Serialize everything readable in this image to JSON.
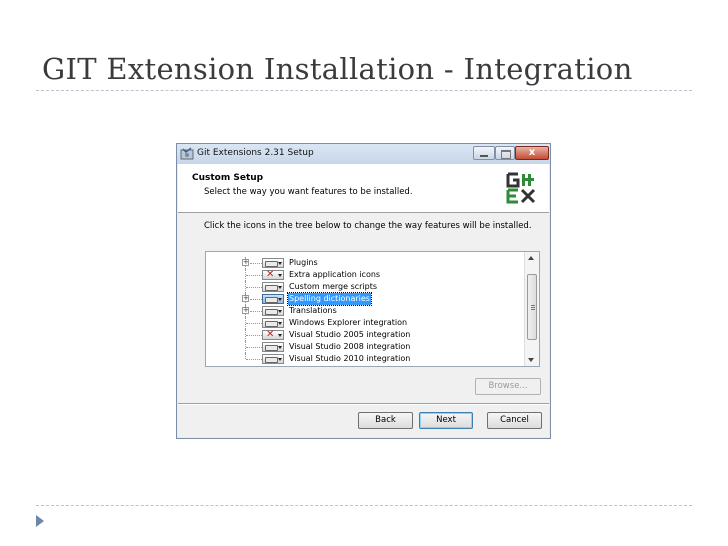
{
  "slide": {
    "title": "GIT Extension Installation - Integration"
  },
  "window": {
    "title": "Git Extensions 2.31 Setup",
    "close_symbol": "x",
    "header": {
      "title": "Custom Setup",
      "subtitle": "Select the way you want features to be installed."
    },
    "instructions": "Click the icons in the tree below to change the way features will be installed.",
    "features": [
      {
        "label": "Plugins",
        "state": "installed",
        "expandable": true
      },
      {
        "label": "Extra application icons",
        "state": "not-installed",
        "expandable": false
      },
      {
        "label": "Custom merge scripts",
        "state": "installed",
        "expandable": false
      },
      {
        "label": "Spelling dictionaries",
        "state": "installed",
        "expandable": true,
        "selected": true
      },
      {
        "label": "Translations",
        "state": "installed",
        "expandable": true
      },
      {
        "label": "Windows Explorer integration",
        "state": "installed",
        "expandable": false
      },
      {
        "label": "Visual Studio 2005 integration",
        "state": "not-installed",
        "expandable": false
      },
      {
        "label": "Visual Studio 2008 integration",
        "state": "installed",
        "expandable": false
      },
      {
        "label": "Visual Studio 2010 integration",
        "state": "installed",
        "expandable": false
      }
    ],
    "buttons": {
      "browse": "Browse...",
      "back": "Back",
      "next": "Next",
      "cancel": "Cancel"
    }
  },
  "colors": {
    "selection": "#3399ff",
    "x_mark": "#c81e1e",
    "logo_green": "#2e8b3a",
    "logo_dark": "#333333"
  },
  "icons": {
    "expander": "plus-expander-icon",
    "feature": "drive-icon",
    "excluded": "red-x-icon"
  }
}
